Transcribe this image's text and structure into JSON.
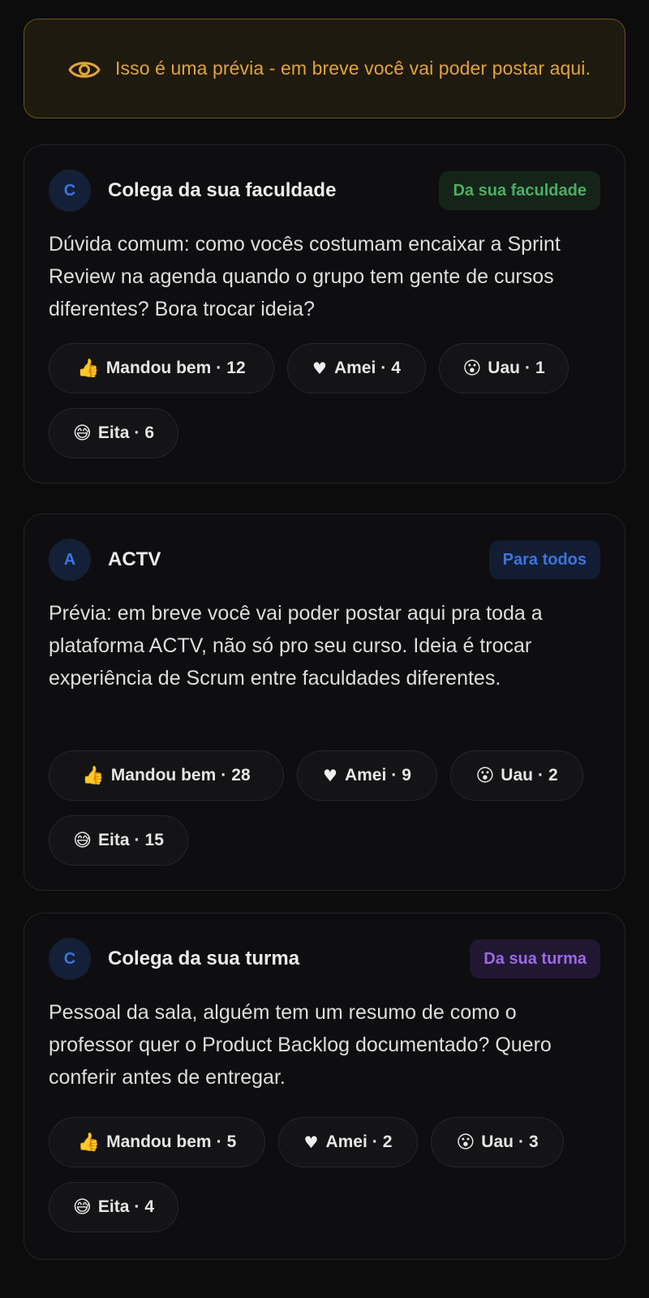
{
  "notice": {
    "text": "Isso é uma prévia - em breve você vai poder postar aqui.",
    "icon": "eye-icon",
    "color": "#e0a53a"
  },
  "posts": [
    {
      "avatar_letter": "C",
      "author": "Colega da sua faculdade",
      "badge": "Da sua faculdade",
      "badge_color": "#4cae63",
      "body": "Dúvida comum: como vocês costumam encaixar a Sprint Review na agenda quando o grupo tem gente de cursos diferentes? Bora trocar ideia?",
      "reactions": [
        {
          "emoji": "👍",
          "label": "Mandou bem",
          "count": "12"
        },
        {
          "emoji": "♥",
          "label": "Amei",
          "count": "4"
        },
        {
          "emoji": "😮",
          "label": "Uau",
          "count": "1"
        },
        {
          "emoji": "😅",
          "label": "Eita",
          "count": "6"
        }
      ]
    },
    {
      "avatar_letter": "A",
      "author": "ACTV",
      "badge": "Para todos",
      "badge_color": "#3d74e0",
      "body": "Prévia: em breve você vai poder postar aqui pra toda a plataforma ACTV, não só pro seu curso. Ideia é trocar experiência de Scrum entre faculdades diferentes.",
      "reactions": [
        {
          "emoji": "👍",
          "label": "Mandou bem",
          "count": "28"
        },
        {
          "emoji": "♥",
          "label": "Amei",
          "count": "9"
        },
        {
          "emoji": "😮",
          "label": "Uau",
          "count": "2"
        },
        {
          "emoji": "😅",
          "label": "Eita",
          "count": "15"
        }
      ]
    },
    {
      "avatar_letter": "C",
      "author": "Colega da sua turma",
      "badge": "Da sua turma",
      "badge_color": "#9a6ae8",
      "body": "Pessoal da sala, alguém tem um resumo de como o professor quer o Product Backlog documentado? Quero conferir antes de entregar.",
      "reactions": [
        {
          "emoji": "👍",
          "label": "Mandou bem",
          "count": "5"
        },
        {
          "emoji": "♥",
          "label": "Amei",
          "count": "2"
        },
        {
          "emoji": "😮",
          "label": "Uau",
          "count": "3"
        },
        {
          "emoji": "😅",
          "label": "Eita",
          "count": "4"
        }
      ]
    }
  ]
}
